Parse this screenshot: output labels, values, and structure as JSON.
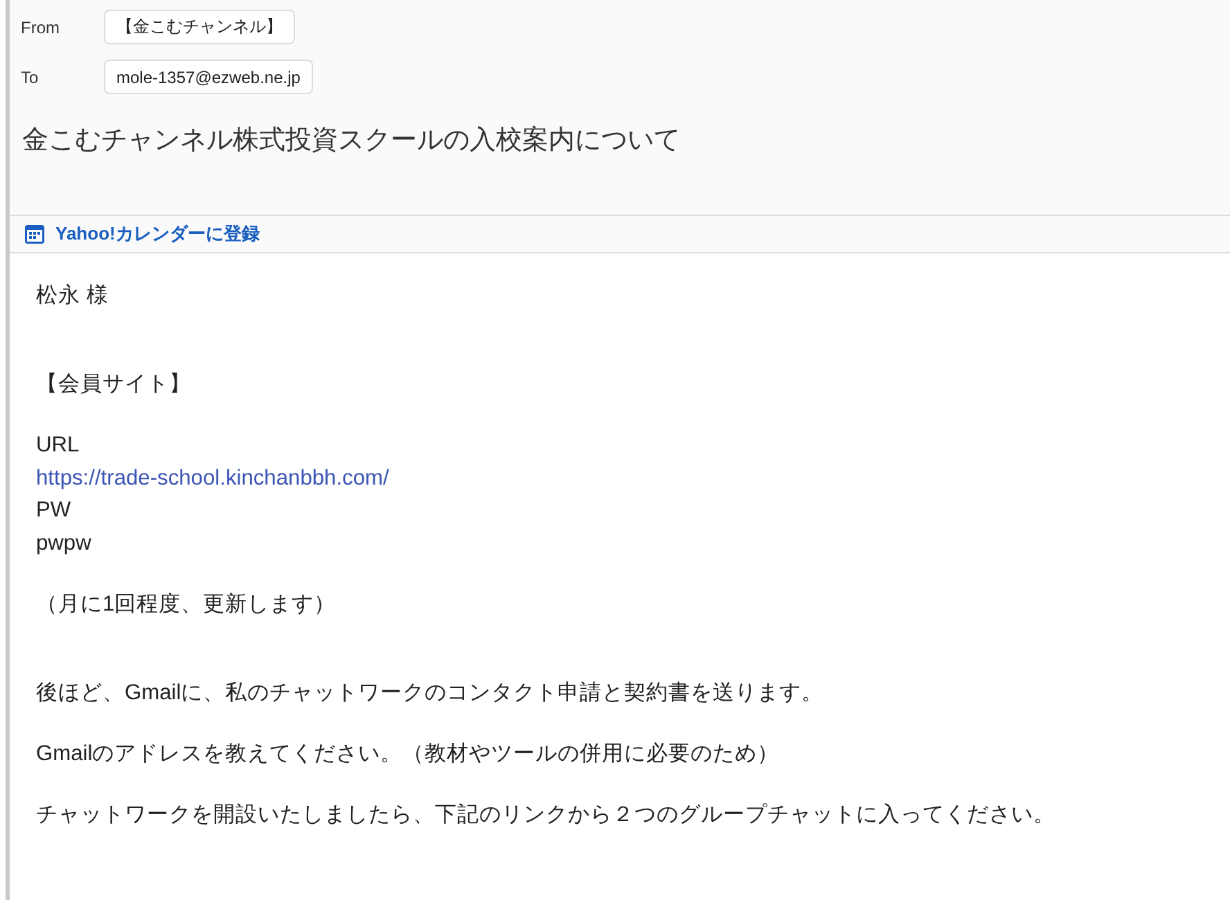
{
  "header": {
    "fields": [
      {
        "label": "From",
        "value": "【金こむチャンネル】"
      },
      {
        "label": "To",
        "value": "mole-1357@ezweb.ne.jp"
      }
    ],
    "subject": "金こむチャンネル株式投資スクールの入校案内について"
  },
  "calendar_action": {
    "label": "Yahoo!カレンダーに登録"
  },
  "body": {
    "sections": [
      {
        "paragraphs": [
          [
            {
              "kind": "text",
              "text": "松永 様"
            }
          ]
        ]
      },
      {
        "paragraphs": [
          [
            {
              "kind": "text",
              "text": "【会員サイト】"
            }
          ],
          [
            {
              "kind": "text",
              "text": "URL"
            },
            {
              "kind": "link",
              "text": "https://trade-school.kinchanbbh.com/"
            },
            {
              "kind": "text",
              "text": "PW"
            },
            {
              "kind": "text",
              "text": "pwpw"
            }
          ],
          [
            {
              "kind": "text",
              "text": "（月に1回程度、更新します）"
            }
          ]
        ]
      },
      {
        "paragraphs": [
          [
            {
              "kind": "text",
              "text": "後ほど、Gmailに、私のチャットワークのコンタクト申請と契約書を送ります。"
            }
          ],
          [
            {
              "kind": "text",
              "text": "Gmailのアドレスを教えてください。（教材やツールの併用に必要のため）"
            }
          ],
          [
            {
              "kind": "text",
              "text": "チャットワークを開設いたしましたら、下記のリンクから２つのグループチャットに入ってください。"
            }
          ]
        ]
      }
    ]
  }
}
